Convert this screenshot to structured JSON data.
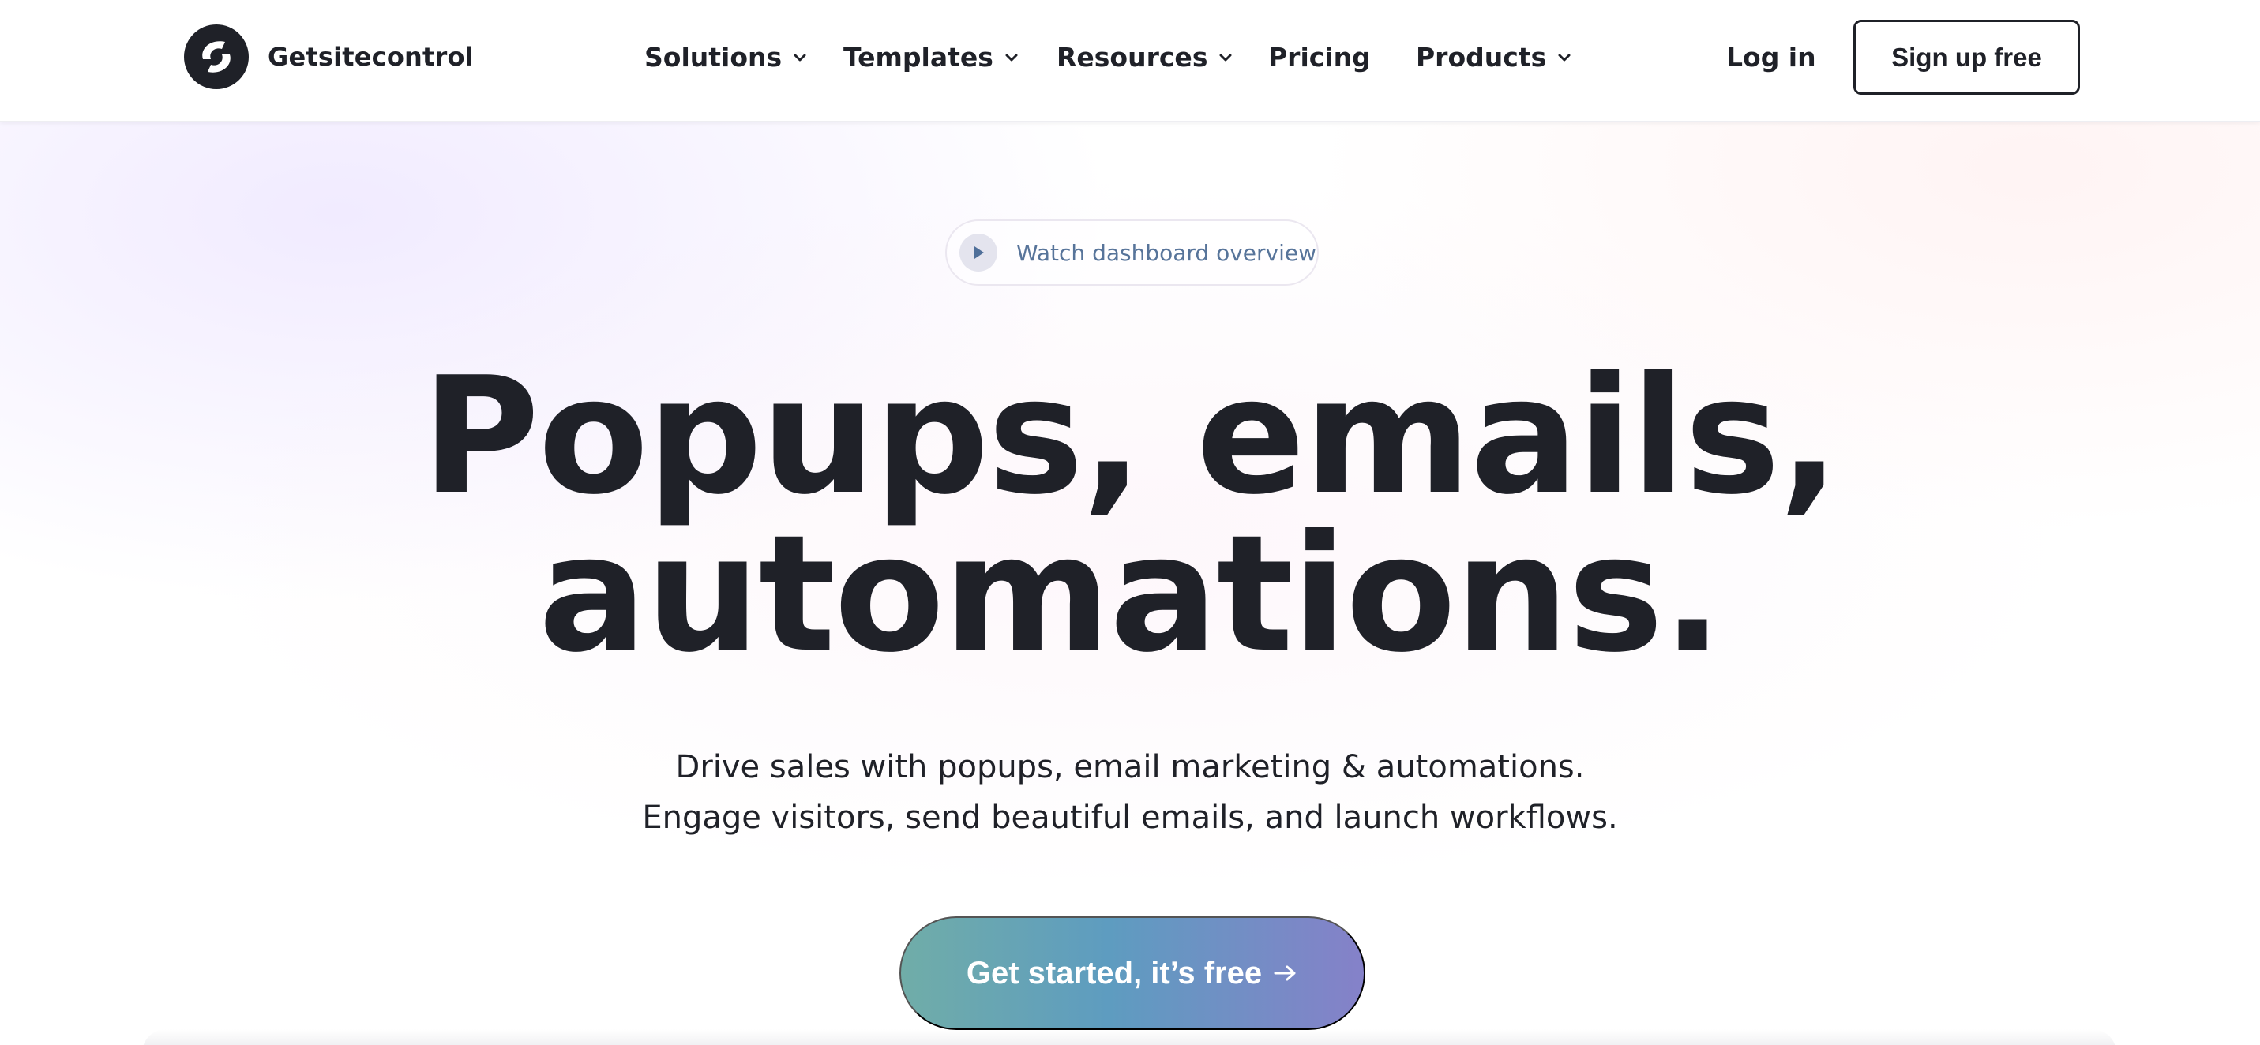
{
  "header": {
    "brand": "Getsitecontrol",
    "nav": [
      {
        "label": "Solutions",
        "has_dropdown": true
      },
      {
        "label": "Templates",
        "has_dropdown": true
      },
      {
        "label": "Resources",
        "has_dropdown": true
      },
      {
        "label": "Pricing",
        "has_dropdown": false
      },
      {
        "label": "Products",
        "has_dropdown": true
      }
    ],
    "login_label": "Log in",
    "signup_label": "Sign up free"
  },
  "hero": {
    "watch_label": "Watch dashboard overview",
    "headline_line1": "Popups, emails,",
    "headline_line2": "automations.",
    "sub_line1": "Drive sales with popups, email marketing & automations.",
    "sub_line2": "Engage visitors, send beautiful emails, and launch workflows.",
    "cta_label": "Get started, it’s free"
  },
  "icons": {
    "logo": "getsitecontrol-logo-icon",
    "chevron": "chevron-down-icon",
    "play": "play-icon",
    "arrow": "arrow-right-icon"
  },
  "colors": {
    "text": "#1f2128",
    "watch_text": "#57749a",
    "cta_gradient_start": "#70ada8",
    "cta_gradient_mid": "#5e9cc0",
    "cta_gradient_end": "#8581c9"
  }
}
